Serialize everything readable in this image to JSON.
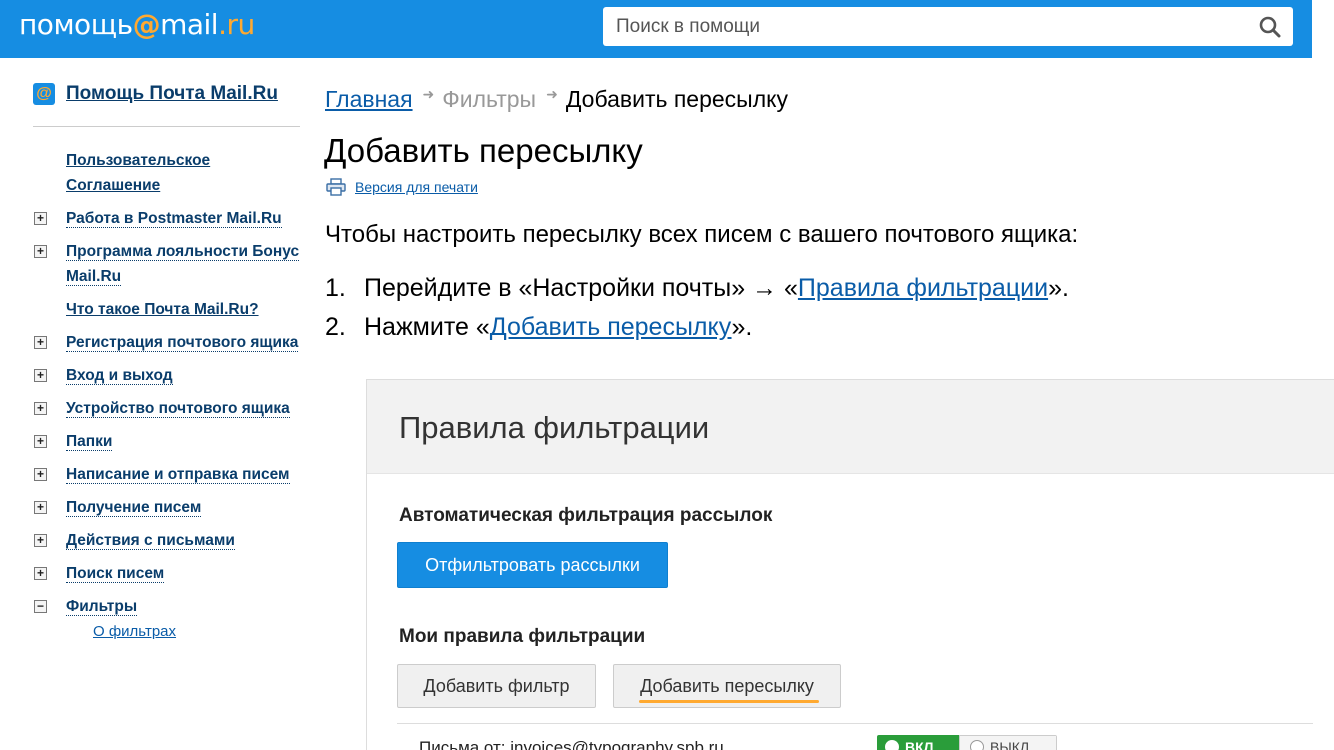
{
  "header": {
    "logo_pre": "помощь",
    "logo_at": "@",
    "logo_mail": "mail",
    "logo_dot_ru": ".ru",
    "search_placeholder": "Поиск в помощи",
    "search_icon": "search-icon"
  },
  "sidebar": {
    "title": "Помощь Почта Mail.Ru",
    "items": [
      {
        "label": "Пользовательское Соглашение",
        "expandable": false
      },
      {
        "label": "Работа в Postmaster Mail.Ru",
        "expandable": true
      },
      {
        "label": "Программа лояльности Бонус Mail.Ru",
        "expandable": true
      },
      {
        "label": "Что такое Почта Mail.Ru?",
        "expandable": false
      },
      {
        "label": "Регистрация почтового ящика",
        "expandable": true
      },
      {
        "label": "Вход и выход",
        "expandable": true
      },
      {
        "label": "Устройство почтового ящика",
        "expandable": true
      },
      {
        "label": "Папки",
        "expandable": true
      },
      {
        "label": "Написание и отправка писем",
        "expandable": true
      },
      {
        "label": "Получение писем",
        "expandable": true
      },
      {
        "label": "Действия с письмами",
        "expandable": true
      },
      {
        "label": "Поиск писем",
        "expandable": true
      },
      {
        "label": "Фильтры",
        "expandable": true,
        "expanded": true
      },
      {
        "label": "О фильтрах",
        "sub": true
      }
    ],
    "toggle_plus": "+",
    "toggle_minus": "−"
  },
  "breadcrumb": {
    "home": "Главная",
    "section": "Фильтры",
    "current": "Добавить пересылку",
    "separator": "➜"
  },
  "main": {
    "title": "Добавить пересылку",
    "print_label": "Версия для печати",
    "intro": "Чтобы настроить пересылку всех писем с вашего почтового ящика:",
    "step1_num": "1.",
    "step1_pre": "Перейдите в «Настройки почты» → «",
    "step1_link": "Правила фильтрации",
    "step1_post": "».",
    "step2_num": "2.",
    "step2_pre": "Нажмите «",
    "step2_link": "Добавить пересылку",
    "step2_post": "»."
  },
  "screenshot": {
    "heading": "Правила фильтрации",
    "auto_title": "Автоматическая фильтрация рассылок",
    "filter_mailings_btn": "Отфильтровать рассылки",
    "my_rules_title": "Мои правила фильтрации",
    "add_filter_btn": "Добавить фильтр",
    "add_forward_btn": "Добавить пересылку",
    "row_text": "Письма от: invoices@typography.spb.ru",
    "toggle_on": "ВКЛ",
    "toggle_off": "ВЫКЛ",
    "accent_color": "#ffa930",
    "primary_color": "#168de2"
  }
}
